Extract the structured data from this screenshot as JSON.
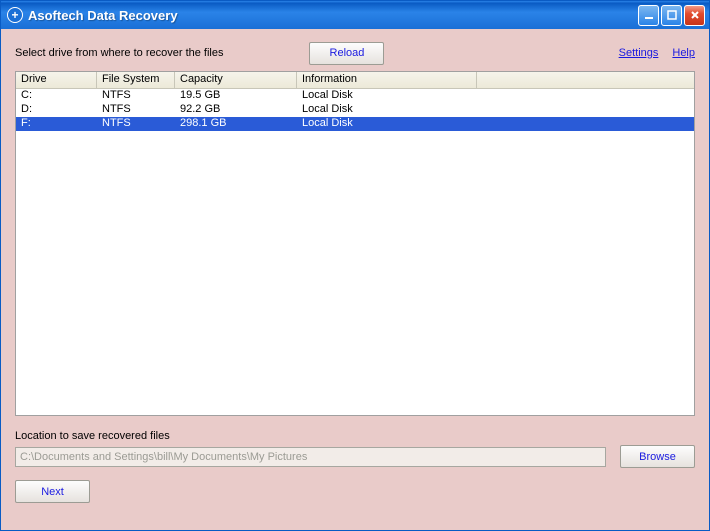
{
  "window": {
    "title": "Asoftech Data Recovery"
  },
  "top": {
    "label": "Select drive from where to recover the files",
    "reload_label": "Reload",
    "settings_label": "Settings",
    "help_label": "Help"
  },
  "table": {
    "headers": {
      "c1": "Drive",
      "c2": "File System",
      "c3": "Capacity",
      "c4": "Information"
    },
    "rows": [
      {
        "drive": "C:",
        "fs": "NTFS",
        "capacity": "19.5 GB",
        "info": "Local Disk",
        "selected": false
      },
      {
        "drive": "D:",
        "fs": "NTFS",
        "capacity": "92.2 GB",
        "info": "Local Disk",
        "selected": false
      },
      {
        "drive": "F:",
        "fs": "NTFS",
        "capacity": "298.1 GB",
        "info": "Local Disk",
        "selected": true
      }
    ]
  },
  "save": {
    "label": "Location to save recovered files",
    "path": "C:\\Documents and Settings\\bill\\My Documents\\My Pictures",
    "browse_label": "Browse"
  },
  "next_label": "Next"
}
